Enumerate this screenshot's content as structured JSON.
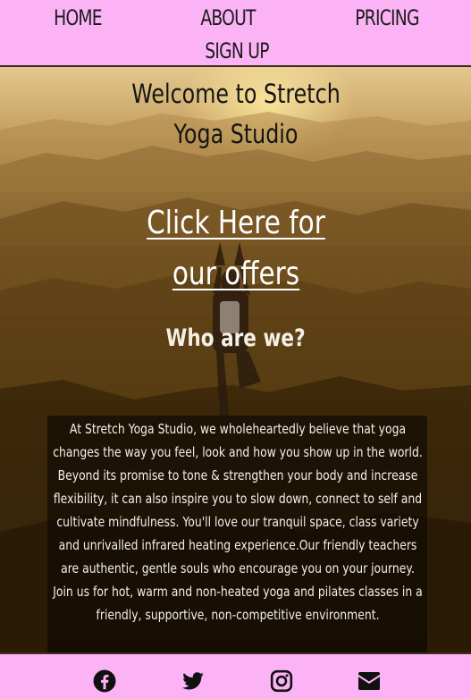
{
  "nav": {
    "items": [
      {
        "label": "HOME"
      },
      {
        "label": "ABOUT"
      },
      {
        "label": "PRICING"
      },
      {
        "label": "SIGN UP"
      }
    ]
  },
  "hero": {
    "title": "Welcome to Stretch Yoga Studio",
    "offers_link": "Click Here for our offers",
    "section_heading": "Who are we?",
    "about_text": "At Stretch Yoga Studio, we wholeheartedly believe that yoga changes the way you feel, look and how you show up in the world. Beyond its promise to tone & strengthen your body and increase flexibility, it can also inspire you to slow down, connect to self and cultivate mindfulness. You'll love our tranquil space, class variety and unrivalled infrared heating experience.Our friendly teachers are authentic, gentle souls who encourage you on your journey. Join us for hot, warm and non-heated yoga and pilates classes in a friendly, supportive, non-competitive environment."
  },
  "footer": {
    "icons": [
      "facebook-icon",
      "twitter-icon",
      "instagram-icon",
      "envelope-icon"
    ]
  },
  "colors": {
    "nav_background": "#fbb3f6",
    "footer_background": "#fbb3f6",
    "link_color": "#ffffff",
    "title_color": "#141414"
  }
}
